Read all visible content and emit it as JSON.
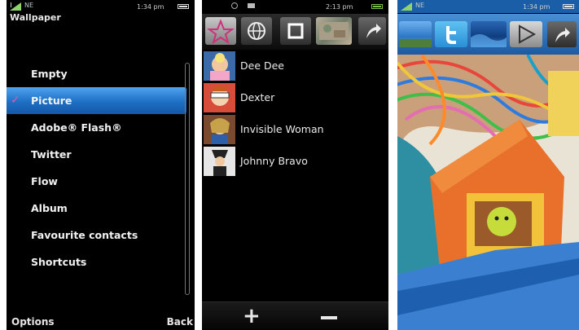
{
  "phone1": {
    "status_time": "1:34 pm",
    "status_net": "NE",
    "title": "Wallpaper",
    "menu_items": [
      "Empty",
      "Picture",
      "Adobe® Flash®",
      "Twitter",
      "Flow",
      "Album",
      "Favourite contacts",
      "Shortcuts"
    ],
    "selected_index": 1,
    "check_glyph": "✓",
    "softkey_left": "Options",
    "softkey_right": "Back"
  },
  "phone2": {
    "status_time": "2:13 pm",
    "tab_icons": [
      "star-icon",
      "globe-icon",
      "square-icon",
      "photo-thumb-icon",
      "arrow-icon"
    ],
    "contacts": [
      {
        "name": "Dee Dee"
      },
      {
        "name": "Dexter"
      },
      {
        "name": "Invisible Woman"
      },
      {
        "name": "Johnny Bravo"
      }
    ],
    "add_glyph": "+",
    "remove_glyph": "−"
  },
  "phone3": {
    "status_time": "1:34 pm",
    "status_net": "NE",
    "tab_icons": [
      "sky-icon",
      "twitter-icon",
      "wave-icon",
      "play-icon",
      "arrow-icon"
    ]
  },
  "colors": {
    "selection_blue": "#2a7fd6",
    "check_pink": "#e05aa0",
    "background": "#000000"
  }
}
